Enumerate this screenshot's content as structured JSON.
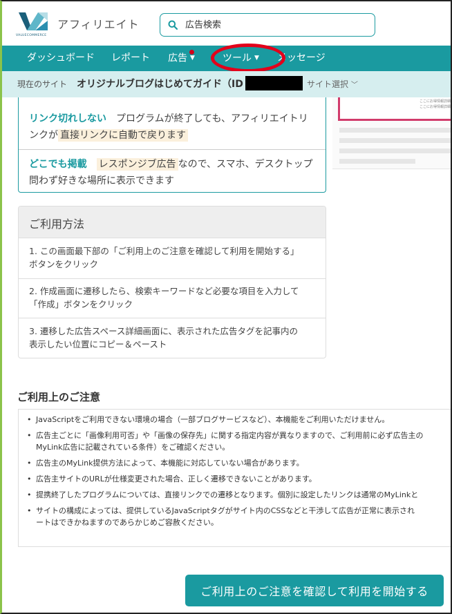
{
  "header": {
    "logo_text": "VALUECOMMERCE",
    "title": "アフィリエイト",
    "search": {
      "placeholder": "広告検索"
    }
  },
  "nav": {
    "items": [
      {
        "label": "ダッシュボード"
      },
      {
        "label": "レポート"
      },
      {
        "label": "広告",
        "has_dropdown": true,
        "has_notification": true
      },
      {
        "label": "ツール",
        "has_dropdown": true,
        "highlighted": true
      },
      {
        "label": "メッセージ"
      }
    ]
  },
  "sitebar": {
    "label": "現在のサイト",
    "site_name": "オリジナルブログはじめてガイド（ID",
    "select_label": "サイト選択"
  },
  "features": [
    {
      "heading": "リンク切れしない",
      "text_before": "プログラムが終了しても、アフィリエイトリンクが",
      "highlight": "直接リンクに自動で戻ります",
      "text_after": ""
    },
    {
      "heading": "どこでも掲載",
      "text_before": "",
      "highlight": "レスポンジブ広告",
      "text_after": "なので、スマホ、デスクトップ問わず好きな場所に表示できます"
    }
  ],
  "preview": {
    "text": [
      "ここにお得情報詳細がはいります",
      "ここにお得情報詳細がはいります"
    ]
  },
  "usage": {
    "title": "ご利用方法",
    "steps": [
      {
        "line1": "1. この画面最下部の「ご利用上のご注意を確認して利用を開始する」",
        "line2": "ボタンをクリック"
      },
      {
        "line1": "2. 作成画面に遷移したら、検索キーワードなど必要な項目を入力して",
        "line2": "「作成」ボタンをクリック"
      },
      {
        "line1": "3. 遷移した広告スペース詳細画面に、表示された広告タグを記事内の",
        "line2": "表示したい位置にコピー＆ペースト"
      }
    ]
  },
  "notes": {
    "title": "ご利用上のご注意",
    "items": [
      {
        "line1": "JavaScriptをご利用できない環境の場合（一部ブログサービスなど）、本機能をご利用いただけません。",
        "line2": ""
      },
      {
        "line1": "広告主ごとに「画像利用可否」や「画像の保存先」に関する指定内容が異なりますので、ご利用前に必ず広告主の",
        "line2": "MyLink広告に記載されている条件）をご確認ください。"
      },
      {
        "line1": "広告主のMyLink提供方法によって、本機能に対応していない場合があります。",
        "line2": ""
      },
      {
        "line1": "広告主サイトのURLが仕様変更された場合、正しく遷移できないことがあります。",
        "line2": ""
      },
      {
        "line1": "提携終了したプログラムについては、直接リンクでの遷移となります。個別に設定したリンクは通常のMyLinkと",
        "line2": ""
      },
      {
        "line1": "サイトの構成によっては、提供しているJavaScriptタグがサイト内のCSSなどと干渉して広告が正常に表示され",
        "line2": "ートはできかねますのであらかじめご容赦ください。"
      }
    ]
  },
  "start_button": {
    "label": "ご利用上のご注意を確認して利用を開始する"
  },
  "colors": {
    "brand": "#1a9aa0",
    "highlight_ring": "#e3001b",
    "sitebar_bg": "#d6eeef",
    "notification": "#d0021b"
  }
}
